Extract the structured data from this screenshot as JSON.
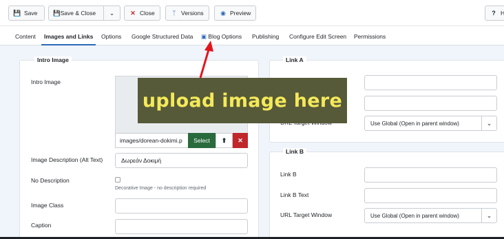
{
  "toolbar": {
    "save_label": "Save",
    "save_close_label": "Save & Close",
    "close_label": "Close",
    "versions_label": "Versions",
    "preview_label": "Preview",
    "help_label": "H"
  },
  "tabs": [
    {
      "label": "Content"
    },
    {
      "label": "Images and Links"
    },
    {
      "label": "Options"
    },
    {
      "label": "Google Structured Data"
    },
    {
      "label": "Blog Options"
    },
    {
      "label": "Publishing"
    },
    {
      "label": "Configure Edit Screen"
    },
    {
      "label": "Permissions"
    }
  ],
  "intro": {
    "legend": "Intro Image",
    "image_label": "Intro Image",
    "image_path": "images/dorean-dokimi.p",
    "select_label": "Select",
    "desc_label": "Image Description (Alt Text)",
    "desc_value": "Δωρεάν Δοκιμή",
    "nodesc_label": "No Description",
    "nodesc_help": "Decorative Image - no description required",
    "class_label": "Image Class",
    "caption_label": "Caption"
  },
  "link_a": {
    "legend": "Link A",
    "url_target_label": "URL Target Window",
    "url_target_value": "Use Global (Open in parent window)"
  },
  "link_b": {
    "legend": "Link B",
    "link_label": "Link B",
    "text_label": "Link B Text",
    "url_target_label": "URL Target Window",
    "url_target_value": "Use Global (Open in parent window)"
  },
  "annotation": {
    "callout_text": "upload image here",
    "color": "#f4e95a",
    "bg": "#565a38",
    "arrow_color": "#e4141b"
  }
}
